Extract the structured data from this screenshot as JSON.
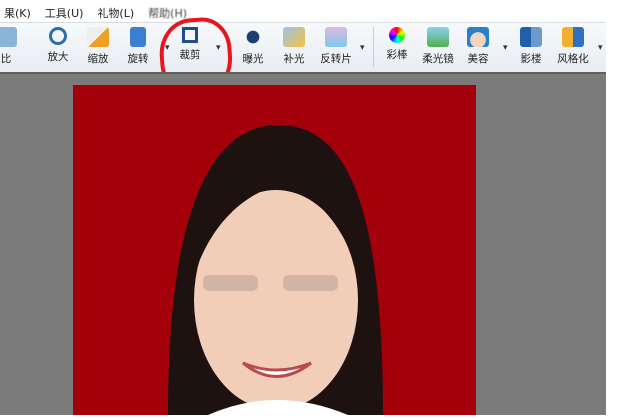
{
  "menu": [
    "果(K)",
    "工具(U)",
    "礼物(L)",
    "帮助(H)"
  ],
  "toolbar": [
    {
      "label": "比",
      "icon": "compare-icon"
    },
    {
      "label": "放大",
      "icon": "zoom-in-icon"
    },
    {
      "label": "缩放",
      "icon": "resize-icon"
    },
    {
      "label": "旋转",
      "icon": "rotate-icon"
    },
    {
      "label": "裁剪",
      "icon": "crop-icon"
    },
    {
      "label": "曝光",
      "icon": "exposure-icon"
    },
    {
      "label": "补光",
      "icon": "fill-light-icon"
    },
    {
      "label": "反转片",
      "icon": "reverse-film-icon"
    },
    {
      "label": "彩棒",
      "icon": "color-wand-icon"
    },
    {
      "label": "柔光镜",
      "icon": "soft-light-icon"
    },
    {
      "label": "美容",
      "icon": "beauty-icon"
    },
    {
      "label": "影楼",
      "icon": "studio-icon"
    },
    {
      "label": "风格化",
      "icon": "stylize-icon"
    }
  ],
  "colors": {
    "photo_bg": "#a4000b",
    "annotation": "#e8141e"
  }
}
